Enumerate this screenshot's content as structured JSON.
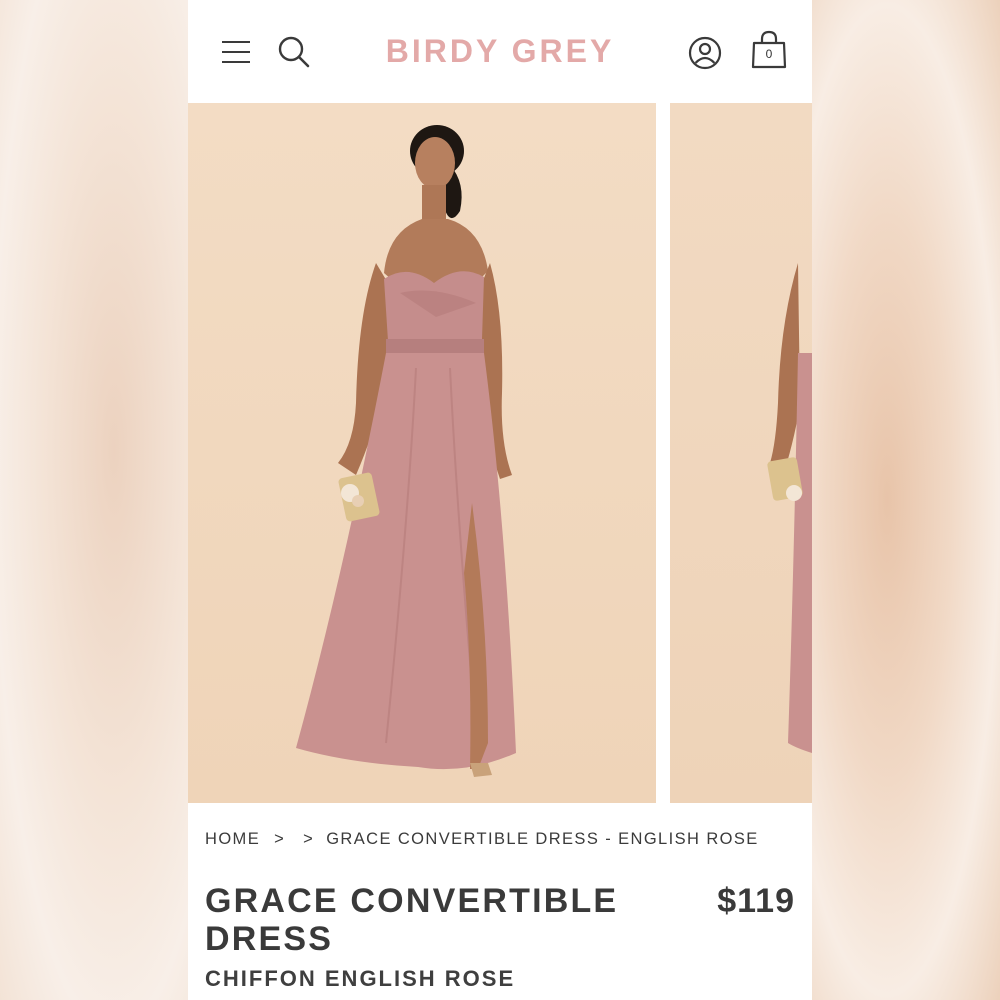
{
  "header": {
    "brand": "BIRDY GREY",
    "bag_count": "0",
    "icons": [
      "menu-icon",
      "search-icon",
      "account-icon",
      "shopping-bag-icon"
    ],
    "brand_color": "#e3a9a8"
  },
  "gallery": {
    "slides": [
      "product-photo-front",
      "product-photo-side"
    ],
    "background_color": "#f1d9c0",
    "dress_color": "#c9918f"
  },
  "breadcrumb": {
    "home": "HOME",
    "separator": ">",
    "current": "GRACE CONVERTIBLE DRESS - ENGLISH ROSE"
  },
  "product": {
    "title": "GRACE CONVERTIBLE DRESS",
    "price": "$119",
    "subtitle": "CHIFFON ENGLISH ROSE"
  }
}
